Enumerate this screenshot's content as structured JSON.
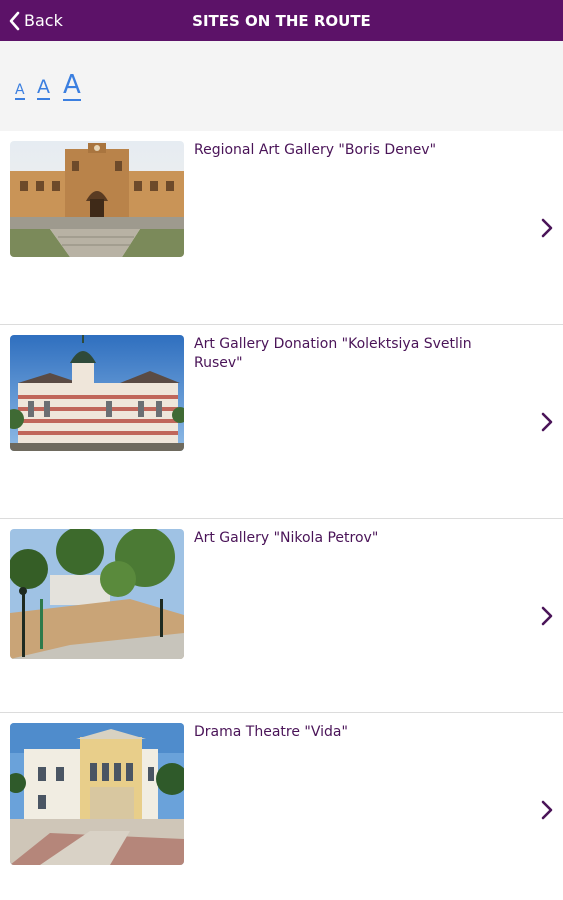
{
  "header": {
    "back_label": "Back",
    "title": "SITES ON THE ROUTE",
    "bar_color": "#5c1268"
  },
  "font_size_controls": {
    "small_label": "A",
    "medium_label": "A",
    "large_label": "A",
    "color": "#3b7fe0"
  },
  "sites": [
    {
      "title": "Regional Art Gallery \"Boris Denev\"",
      "image": "gallery-building-photo"
    },
    {
      "title": "Art Gallery Donation \"Kolektsiya Svetlin Rusev\"",
      "image": "domed-striped-building-photo"
    },
    {
      "title": "Art Gallery \"Nikola Petrov\"",
      "image": "park-trees-photo"
    },
    {
      "title": "Drama Theatre \"Vida\"",
      "image": "theatre-building-photo"
    }
  ]
}
